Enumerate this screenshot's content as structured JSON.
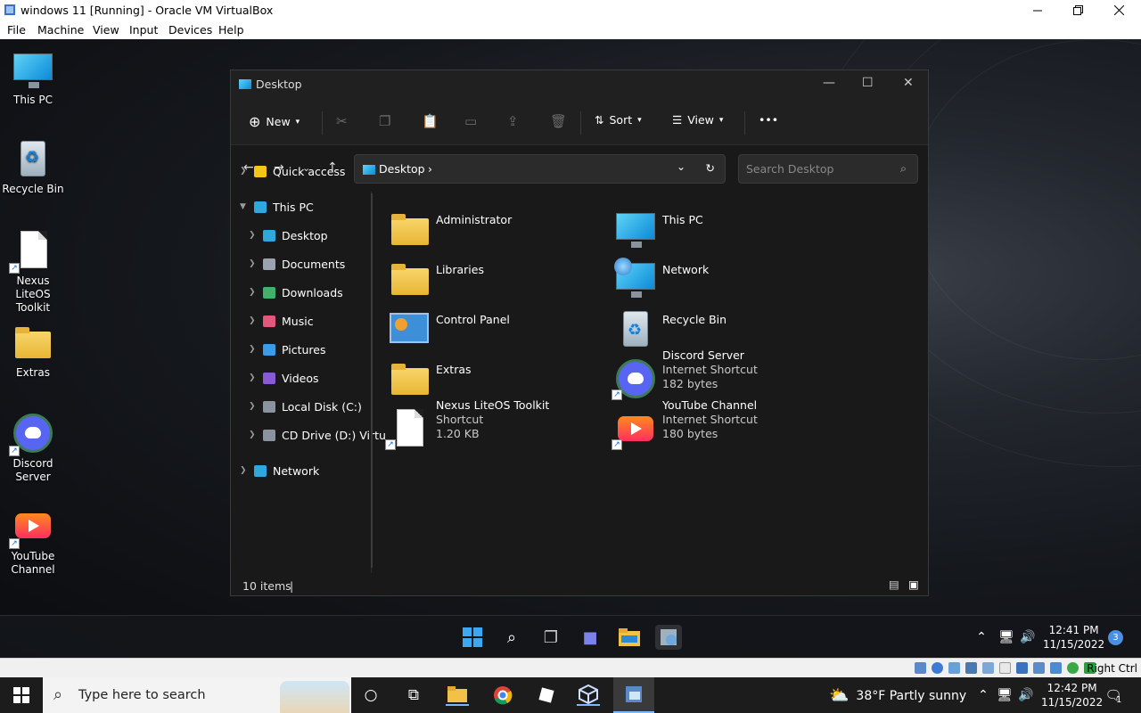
{
  "vbox": {
    "title": "windows 11 [Running] - Oracle VM VirtualBox",
    "menu": [
      "File",
      "Machine",
      "View",
      "Input",
      "Devices",
      "Help"
    ],
    "status_right": "Right Ctrl"
  },
  "desktop_icons": [
    {
      "label": "This PC",
      "icon": "monitor-icon"
    },
    {
      "label": "Recycle Bin",
      "icon": "recycle-bin-icon"
    },
    {
      "label": "Nexus LiteOS Toolkit",
      "icon": "document-shortcut-icon"
    },
    {
      "label": "Extras",
      "icon": "folder-icon"
    },
    {
      "label": "Discord Server",
      "icon": "discord-icon"
    },
    {
      "label": "YouTube Channel",
      "icon": "youtube-icon"
    }
  ],
  "explorer": {
    "title": "Desktop",
    "cmd": {
      "new": "New",
      "sort": "Sort",
      "view": "View",
      "more": "•••"
    },
    "address": "Desktop",
    "search_placeholder": "Search Desktop",
    "nav": [
      {
        "label": "Quick access",
        "color": "#f5c518",
        "expanded": false
      },
      {
        "label": "This PC",
        "color": "#2fa8e0",
        "expanded": true
      },
      {
        "label": "Desktop",
        "color": "#2fa8e0"
      },
      {
        "label": "Documents",
        "color": "#9aa4ae"
      },
      {
        "label": "Downloads",
        "color": "#3fb36c"
      },
      {
        "label": "Music",
        "color": "#e2577a"
      },
      {
        "label": "Pictures",
        "color": "#3a9be8"
      },
      {
        "label": "Videos",
        "color": "#8a5ad6"
      },
      {
        "label": "Local Disk (C:)",
        "color": "#8a949e"
      },
      {
        "label": "CD Drive (D:) Virtu",
        "color": "#8a949e"
      },
      {
        "label": "Network",
        "color": "#2fa8e0"
      }
    ],
    "files": [
      {
        "name": "Administrator",
        "sub1": "",
        "sub2": "",
        "icon": "folder-icon"
      },
      {
        "name": "This PC",
        "sub1": "",
        "sub2": "",
        "icon": "monitor-icon"
      },
      {
        "name": "Libraries",
        "sub1": "",
        "sub2": "",
        "icon": "folder-icon"
      },
      {
        "name": "Network",
        "sub1": "",
        "sub2": "",
        "icon": "network-icon"
      },
      {
        "name": "Control Panel",
        "sub1": "",
        "sub2": "",
        "icon": "control-panel-icon"
      },
      {
        "name": "Recycle Bin",
        "sub1": "",
        "sub2": "",
        "icon": "recycle-bin-icon"
      },
      {
        "name": "Extras",
        "sub1": "",
        "sub2": "",
        "icon": "folder-icon"
      },
      {
        "name": "Discord Server",
        "sub1": "Internet Shortcut",
        "sub2": "182 bytes",
        "icon": "discord-icon"
      },
      {
        "name": "Nexus LiteOS Toolkit",
        "sub1": "Shortcut",
        "sub2": "1.20 KB",
        "icon": "document-shortcut-icon"
      },
      {
        "name": "YouTube Channel",
        "sub1": "Internet Shortcut",
        "sub2": "180 bytes",
        "icon": "youtube-icon"
      }
    ],
    "status": "10 items"
  },
  "guest_taskbar": {
    "time": "12:41 PM",
    "date": "11/15/2022",
    "badge": "3"
  },
  "host_taskbar": {
    "search": "Type here to search",
    "weather": "38°F  Partly sunny",
    "time": "12:42 PM",
    "date": "11/15/2022",
    "notif": "1"
  }
}
